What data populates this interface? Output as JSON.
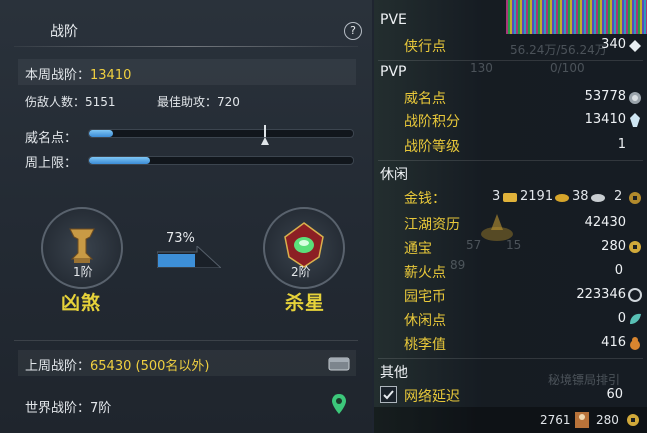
{
  "left_panel": {
    "title": "战阶",
    "help": "?",
    "weekly_label": "本周战阶：",
    "weekly_value": "13410",
    "kills_label": "伤敌人数：",
    "kills_value": "5151",
    "assist_label": "最佳助攻：",
    "assist_value": "720",
    "prestige_label": "威名点：",
    "prestige_progress": 0.09,
    "prestige_marker": 0.67,
    "weekly_cap_label": "周上限：",
    "weekly_cap_progress": 0.23,
    "current_rank": {
      "level": "1阶",
      "name": "凶煞"
    },
    "next_rank": {
      "level": "2阶",
      "name": "杀星"
    },
    "progress_percent": "73%",
    "last_week_label": "上周战阶：",
    "last_week_value": "65430 (500名以外)",
    "world_label": "世界战阶：",
    "world_value": "7阶"
  },
  "right_panel": {
    "pve_title": "PVE",
    "pve_items": [
      {
        "label": "侠行点",
        "value": "340",
        "icon": "gem-icon"
      }
    ],
    "pvp_title": "PVP",
    "pvp_items": [
      {
        "label": "威名点",
        "value": "53778",
        "icon": "medal-icon"
      },
      {
        "label": "战阶积分",
        "value": "13410",
        "icon": "crystal-icon"
      },
      {
        "label": "战阶等级",
        "value": "1"
      }
    ],
    "leisure_title": "休闲",
    "money": {
      "label": "金钱：",
      "a": "3",
      "b": "2191",
      "c": "38",
      "d": "2"
    },
    "leisure_items": [
      {
        "label": "江湖资历",
        "value": "42430"
      },
      {
        "label": "通宝",
        "value": "280",
        "icon": "coin-icon"
      },
      {
        "label": "薪火点",
        "value": "0"
      },
      {
        "label": "园宅币",
        "value": "223346",
        "icon": "house-coin-icon"
      },
      {
        "label": "休闲点",
        "value": "0",
        "icon": "leaf-icon"
      },
      {
        "label": "桃李值",
        "value": "416",
        "icon": "gourd-icon"
      }
    ],
    "other_title": "其他",
    "latency_label": "网络延迟",
    "latency_value": "60",
    "bottom_left_value": "2761",
    "bottom_right_value": "280",
    "bg_text": [
      "56.24万/56.24万",
      "130",
      "0/100",
      "57",
      "15",
      "89",
      "秘境镖局排引"
    ]
  },
  "colors": {
    "accent_gold": "#f0d040",
    "bar_blue": "#3b8cd6",
    "text": "#e2e6ea"
  }
}
